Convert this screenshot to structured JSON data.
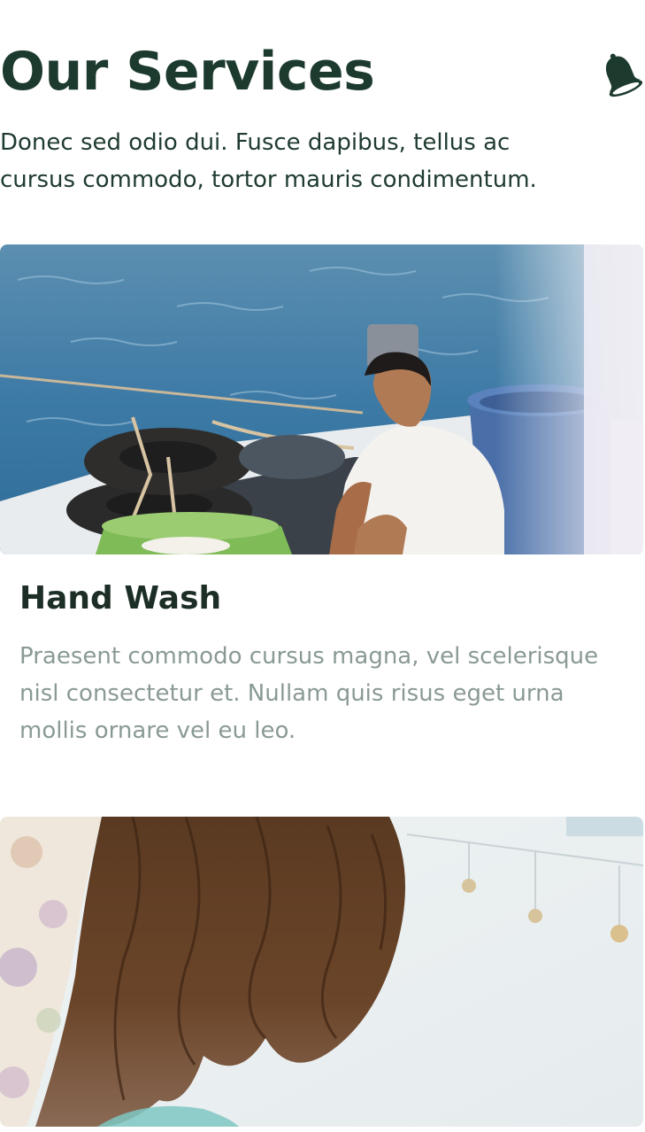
{
  "header": {
    "title": "Our Services",
    "notification_icon": "bell-icon"
  },
  "intro": {
    "text": "Donec sed odio dui. Fusce dapibus, tellus ac cursus commodo, tortor mauris condimentum."
  },
  "services": [
    {
      "title": "Hand Wash",
      "description": "Praesent commodo cursus magna, vel scelerisque nisl consectetur et. Nullam quis risus eget urna mollis ornare vel eu leo."
    }
  ],
  "colors": {
    "heading": "#1c3a2d",
    "body_text": "#1f3b2f",
    "muted_text": "#8a9a93",
    "background": "#ffffff"
  }
}
